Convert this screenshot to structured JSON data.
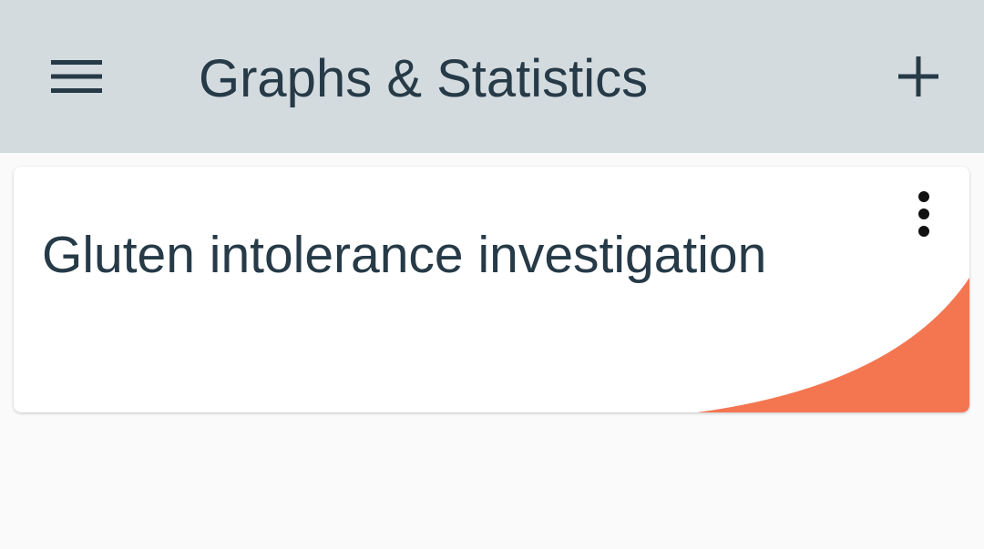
{
  "app_bar": {
    "title": "Graphs & Statistics",
    "menu_icon": "hamburger-menu-icon",
    "add_icon": "plus-icon",
    "background": "#d3dbdf",
    "text_color": "#263a47"
  },
  "cards": [
    {
      "title": "Gluten intolerance investigation",
      "menu_icon": "more-vertical-icon",
      "accent_color": "#f47651"
    }
  ]
}
